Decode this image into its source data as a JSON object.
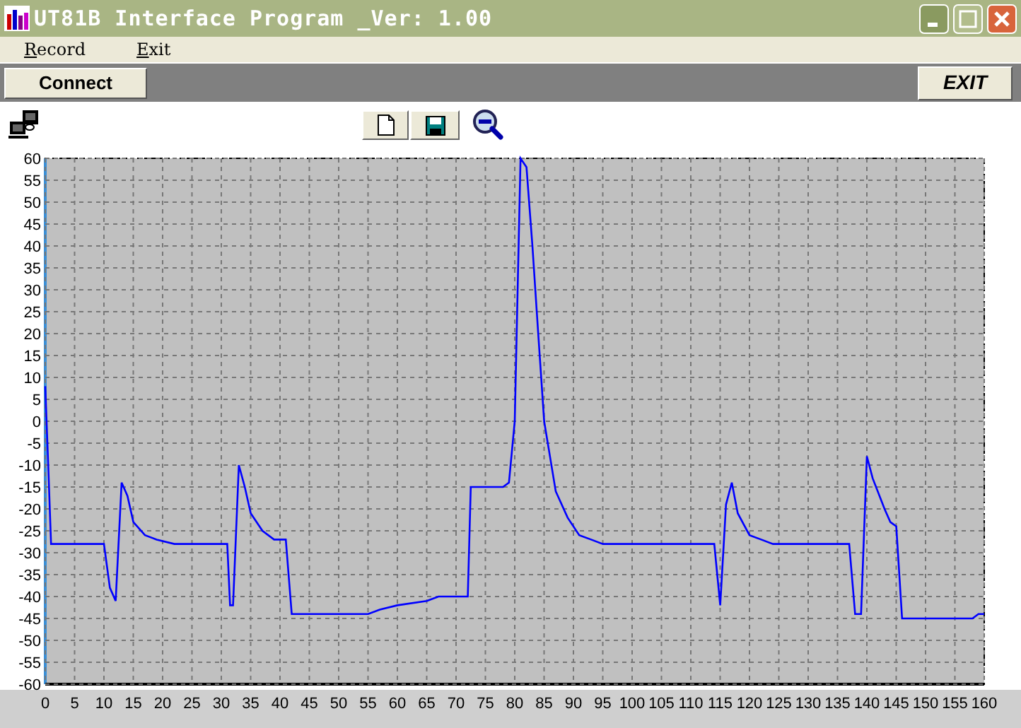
{
  "window": {
    "title": "UT81B Interface Program _Ver: 1.00"
  },
  "menu": [
    {
      "label": "Record"
    },
    {
      "label": "Exit"
    }
  ],
  "toolbar": {
    "connect_button": "Connect",
    "exit_button": "EXIT"
  },
  "plot": {
    "chart_data": {
      "type": "line",
      "grid": true,
      "x": [
        0,
        0.5,
        1,
        10,
        11,
        12,
        13,
        14,
        15,
        17,
        19,
        22,
        31,
        31.5,
        32,
        33,
        34,
        35,
        37,
        39,
        41,
        42,
        43,
        55,
        57,
        60,
        65,
        67,
        72,
        72.5,
        73,
        78,
        79,
        80,
        81,
        82,
        83,
        84,
        85,
        86,
        87,
        89,
        91,
        93,
        95,
        114,
        115,
        116,
        117,
        118,
        120,
        122,
        124,
        137,
        138,
        139,
        140,
        141,
        143,
        144,
        145,
        146,
        158,
        159,
        160
      ],
      "series": [
        {
          "color": "#0000ff",
          "values": [
            8,
            -10,
            -28,
            -28,
            -38,
            -41,
            -14,
            -17,
            -23,
            -26,
            -27,
            -28,
            -28,
            -42,
            -42,
            -10,
            -15,
            -21,
            -25,
            -27,
            -27,
            -44,
            -44,
            -44,
            -43,
            -42,
            -41,
            -40,
            -40,
            -15,
            -15,
            -15,
            -14,
            0,
            60,
            58,
            40,
            20,
            0,
            -8,
            -16,
            -22,
            -26,
            -27,
            -28,
            -28,
            -42,
            -19,
            -14,
            -21,
            -26,
            -27,
            -28,
            -28,
            -44,
            -44,
            -8,
            -13,
            -20,
            -23,
            -24,
            -45,
            -45,
            -44,
            -44
          ]
        }
      ],
      "xlim": [
        0,
        160
      ],
      "ylim": [
        -60,
        60
      ],
      "xticks": [
        0,
        5,
        10,
        15,
        20,
        25,
        30,
        35,
        40,
        45,
        50,
        55,
        60,
        65,
        70,
        75,
        80,
        85,
        90,
        95,
        100,
        105,
        110,
        115,
        120,
        125,
        130,
        135,
        140,
        145,
        150,
        155,
        160
      ],
      "yticks": [
        60,
        55,
        50,
        45,
        40,
        35,
        30,
        25,
        20,
        15,
        10,
        5,
        0,
        -5,
        -10,
        -15,
        -20,
        -25,
        -30,
        -35,
        -40,
        -45,
        -50,
        -55,
        -60
      ]
    }
  }
}
